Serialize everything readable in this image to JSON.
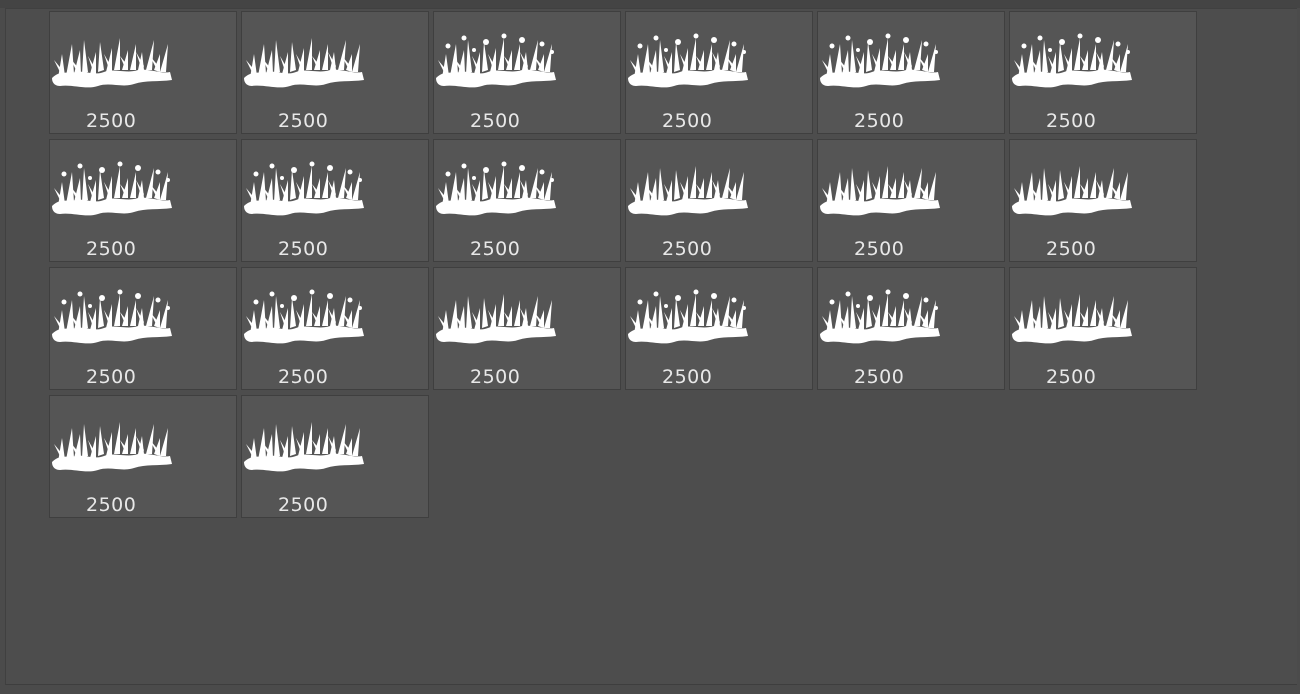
{
  "brush_panel": {
    "brushes": [
      {
        "size": "2500",
        "icon": "grass-brush-icon",
        "variant": "plain"
      },
      {
        "size": "2500",
        "icon": "grass-brush-icon",
        "variant": "plain"
      },
      {
        "size": "2500",
        "icon": "grass-flower-brush-icon",
        "variant": "flowers"
      },
      {
        "size": "2500",
        "icon": "grass-flower-brush-icon",
        "variant": "flowers"
      },
      {
        "size": "2500",
        "icon": "grass-flower-brush-icon",
        "variant": "flowers"
      },
      {
        "size": "2500",
        "icon": "grass-flower-brush-icon",
        "variant": "flowers"
      },
      {
        "size": "2500",
        "icon": "grass-flower-brush-icon",
        "variant": "flowers"
      },
      {
        "size": "2500",
        "icon": "grass-flower-brush-icon",
        "variant": "flowers"
      },
      {
        "size": "2500",
        "icon": "grass-flower-brush-icon",
        "variant": "flowers"
      },
      {
        "size": "2500",
        "icon": "grass-brush-icon",
        "variant": "plain"
      },
      {
        "size": "2500",
        "icon": "grass-brush-icon",
        "variant": "plain"
      },
      {
        "size": "2500",
        "icon": "grass-brush-icon",
        "variant": "plain"
      },
      {
        "size": "2500",
        "icon": "grass-flower-brush-icon",
        "variant": "flowers"
      },
      {
        "size": "2500",
        "icon": "grass-flower-brush-icon",
        "variant": "flowers"
      },
      {
        "size": "2500",
        "icon": "grass-brush-icon",
        "variant": "plain"
      },
      {
        "size": "2500",
        "icon": "grass-flower-brush-icon",
        "variant": "flowers"
      },
      {
        "size": "2500",
        "icon": "grass-flower-brush-icon",
        "variant": "flowers"
      },
      {
        "size": "2500",
        "icon": "grass-brush-icon",
        "variant": "plain"
      },
      {
        "size": "2500",
        "icon": "grass-brush-icon",
        "variant": "plain"
      },
      {
        "size": "2500",
        "icon": "grass-brush-icon",
        "variant": "plain"
      }
    ]
  }
}
